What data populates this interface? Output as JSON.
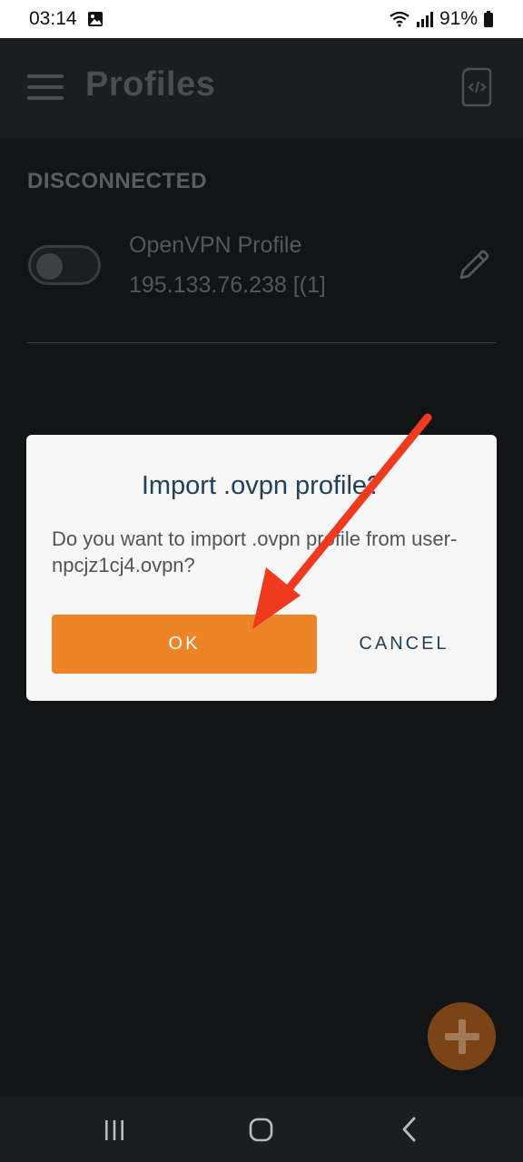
{
  "status_bar": {
    "time": "03:14",
    "battery": "91%",
    "icons": [
      "gallery-icon",
      "wifi-icon",
      "signal-icon",
      "battery-icon"
    ]
  },
  "app_bar": {
    "title": "Profiles",
    "menu_icon": "hamburger-menu-icon",
    "action_icon": "import-file-icon"
  },
  "profiles_section": {
    "header": "DISCONNECTED",
    "items": [
      {
        "name": "OpenVPN Profile",
        "server": "195.133.76.238 [(1]",
        "connected": false
      }
    ]
  },
  "dialog": {
    "title": "Import .ovpn profile?",
    "message": "Do you want to import .ovpn profile from user-npcjz1cj4.ovpn?",
    "ok_label": "OK",
    "cancel_label": "CANCEL"
  },
  "fab": {
    "icon": "plus-icon"
  },
  "nav_bar": {
    "icons": [
      "recent-apps-icon",
      "home-icon",
      "back-icon"
    ]
  },
  "colors": {
    "accent": "#ee8428",
    "background": "#121416",
    "dialog_title": "#22405a",
    "annotation_arrow": "#f03a1f"
  }
}
